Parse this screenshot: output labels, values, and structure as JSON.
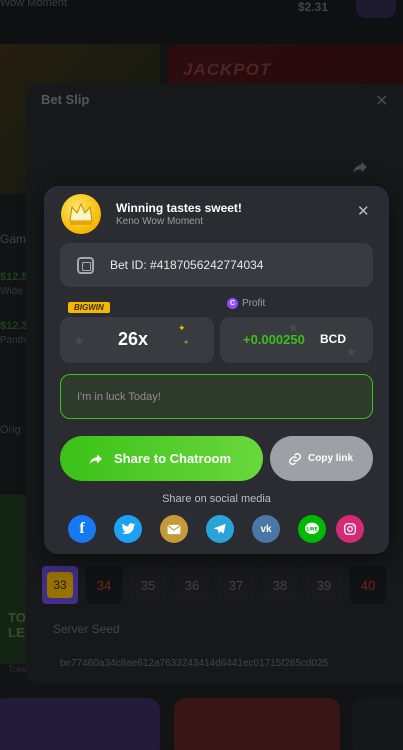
{
  "background": {
    "top_text": "Wow Moment",
    "top_amount": "$2.31",
    "jackpot": "JACKPOT",
    "side_texts": [
      "Gam",
      "$12.5",
      "Wide",
      "$12.3",
      "Panth",
      "Orig"
    ],
    "card_text": "TO\nLE",
    "legends": "Token Legends"
  },
  "betslip": {
    "title": "Bet Slip",
    "numbers": [
      "33",
      "34",
      "35",
      "36",
      "37",
      "38",
      "39",
      "40"
    ],
    "server_seed_label": "Server Seed",
    "seed_hash": "be77460a34c8ae612a7633243414d6441ec01715f285cd025"
  },
  "modal": {
    "title": "Winning tastes sweet!",
    "subtitle": "Keno Wow Moment",
    "bet_id": "Bet ID: #4187056242774034",
    "badge": "BIGWIN",
    "multiplier": "26x",
    "profit_label": "Profit",
    "profit_value": "+0.000250",
    "profit_unit": "BCD",
    "message_placeholder": "I'm in luck Today!",
    "share_button": "Share to Chatroom",
    "copy_button": "Copy link",
    "social_title": "Share on social media"
  },
  "social_icons": [
    "facebook-icon",
    "twitter-icon",
    "email-icon",
    "telegram-icon",
    "vk-icon",
    "line-icon",
    "instagram-icon"
  ],
  "colors": {
    "accent_green": "#3bc117",
    "gold": "#f5b800",
    "panel": "#2b2c31"
  }
}
